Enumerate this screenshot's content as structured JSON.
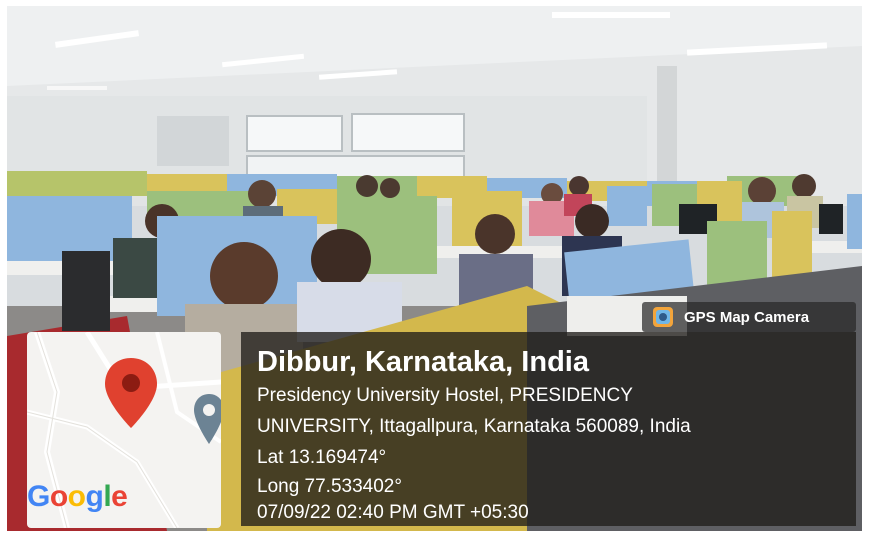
{
  "overlay": {
    "app_badge": "GPS Map Camera",
    "location_title": "Dibbur, Karnataka, India",
    "address_line1": "Presidency University Hostel, PRESIDENCY",
    "address_line2": "UNIVERSITY, Ittagallpura, Karnataka 560089, India",
    "latitude": "Lat 13.169474°",
    "longitude": "Long 77.533402°",
    "timestamp": "07/09/22 02:40 PM GMT +05:30",
    "map_brand": "Google"
  },
  "colors": {
    "pin": "#e0412f",
    "secondary_pin": "#6c8394",
    "overlay_bg": "#201e1a",
    "divider_blue": "#8fb6de",
    "divider_green": "#9cc07d",
    "divider_yellow": "#d9c35c"
  },
  "icons": [
    "map-pin-icon",
    "secondary-pin-icon",
    "gps-camera-icon"
  ]
}
